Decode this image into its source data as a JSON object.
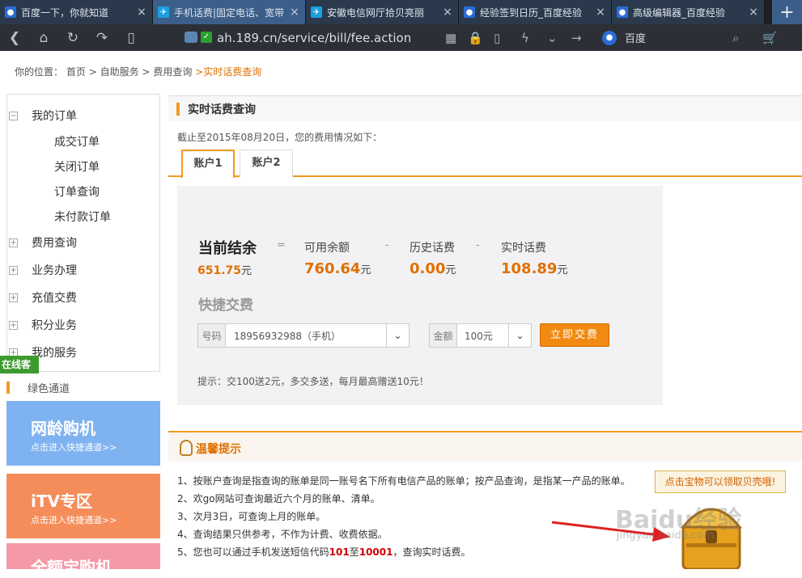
{
  "browser": {
    "tabs": [
      {
        "title": "百度一下，你就知道",
        "active": false,
        "icon": "baidu-paw-icon"
      },
      {
        "title": "手机话费|固定电话、宽带",
        "active": true,
        "icon": "telecom-icon"
      },
      {
        "title": "安徽电信网厅拾贝亮丽",
        "active": false,
        "icon": "telecom-icon"
      },
      {
        "title": "经验签到日历_百度经验",
        "active": false,
        "icon": "baidu-paw-icon"
      },
      {
        "title": "高级编辑器_百度经验",
        "active": false,
        "icon": "baidu-paw-icon"
      }
    ],
    "url": "ah.189.cn/service/bill/fee.action",
    "search_engine": "百度",
    "new_tab": "+",
    "close": "×"
  },
  "breadcrumb": {
    "prefix": "你的位置：",
    "items": [
      "首页",
      "自助服务",
      "费用查询"
    ],
    "sep": ">",
    "current": ">实时话费查询"
  },
  "sidebar": {
    "expanded": {
      "label": "我的订单",
      "children": [
        "成交订单",
        "关闭订单",
        "订单查询",
        "未付款订单"
      ]
    },
    "collapsed": [
      "费用查询",
      "业务办理",
      "充值交费",
      "积分业务",
      "我的服务"
    ],
    "online_service": "在线客服",
    "green_channel": "绿色通道",
    "cards": [
      {
        "title": "网龄购机",
        "subtitle": "点击进入快捷通道>>",
        "color": "#7fb2f0"
      },
      {
        "title": "iTV专区",
        "subtitle": "点击进入快捷通道>>",
        "color": "#f58d5a"
      },
      {
        "title": "全额宝购机",
        "subtitle": "",
        "color": "#f49aa6"
      }
    ]
  },
  "main": {
    "title": "实时话费查询",
    "desc": "截止至2015年08月20日，您的费用情况如下：",
    "tabs": [
      "账户1",
      "账户2"
    ],
    "current_balance_label": "当前结余",
    "current_balance": "651.75",
    "unit": "元",
    "eq": "=",
    "minus": "-",
    "available_label": "可用余额",
    "available": "760.64",
    "history_label": "历史话费",
    "history": "0.00",
    "realtime_label": "实时话费",
    "realtime": "108.89",
    "quick_pay": "快捷交费",
    "phone_label": "号码",
    "phone_value": "18956932988（手机）",
    "amount_label": "金额",
    "amount_value": "100元",
    "pay_button": "立即交费",
    "tip": "提示：交100送2元，多交多送，每月最高赠送10元！"
  },
  "warm": {
    "title": "温馨提示",
    "lines": [
      {
        "pre": "1、按账户查询是指查询的账单是同一账号名下所有电信产品的账单；按产品查询，是指某一产品的账单。"
      },
      {
        "pre": "2、欢go网站可查询最近六个月的账单、清单。"
      },
      {
        "pre": "3、次月3日，可查询上月的账单。"
      },
      {
        "pre": "4、查询结果只供参考，不作为计费、收费依据。"
      },
      {
        "pre": "5、您也可以通过手机发送短信代码",
        "b1": "101",
        "mid": "至",
        "b2": "10001",
        "post": "，查询实时话费。"
      }
    ],
    "treasure_badge": "点击宝物可以领取贝壳哦!",
    "watermark": "Baidu经验",
    "watermark_url": "jingyan.baidu.com"
  }
}
